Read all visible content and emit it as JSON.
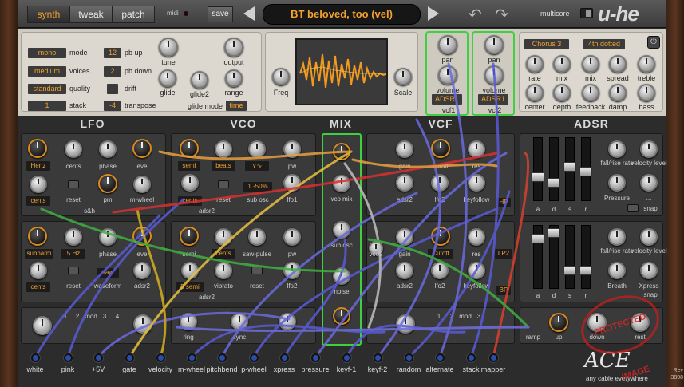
{
  "topbar": {
    "tabs": [
      {
        "label": "synth",
        "active": true
      },
      {
        "label": "tweak",
        "active": false
      },
      {
        "label": "patch",
        "active": false
      }
    ],
    "midi_label": "midi",
    "save_label": "save",
    "preset_name": "BT beloved, too (vel)",
    "multicore_label": "multicore",
    "logo_text": "u-he"
  },
  "global": {
    "mode": {
      "value": "mono",
      "label": "mode"
    },
    "voices": {
      "value": "medium",
      "label": "voices"
    },
    "quality": {
      "value": "standard",
      "label": "quality"
    },
    "stack": {
      "value": "1",
      "label": "stack"
    },
    "pb_up": {
      "value": "12",
      "label": "pb up"
    },
    "pb_down": {
      "value": "2",
      "label": "pb down"
    },
    "drift": {
      "label": "drift"
    },
    "transpose": {
      "value": "-4",
      "label": "transpose"
    },
    "knob_labels": {
      "tune": "tune",
      "output": "output",
      "glide": "glide",
      "glide2": "glide2",
      "range": "range"
    },
    "glide_mode": {
      "label": "glide mode",
      "value": "time"
    }
  },
  "scope": {
    "freq_label": "Freq",
    "scale_label": "Scale"
  },
  "vcf_outputs": [
    {
      "pan": "pan",
      "volume": "volume",
      "env": "ADSR1",
      "name": "vcf1"
    },
    {
      "pan": "pan",
      "volume": "volume",
      "env": "ADSR1",
      "name": "vcf2"
    }
  ],
  "effects": {
    "chorus": "Chorus 3",
    "delay": "4th dotted",
    "row1": [
      "rate",
      "mix",
      "mix",
      "spread",
      "treble"
    ],
    "row2": [
      "center",
      "depth",
      "feedback",
      "damp",
      "bass"
    ]
  },
  "sections": {
    "lfo": "LFO",
    "vco": "VCO",
    "mix": "MIX",
    "vcf": "VCF",
    "adsr": "ADSR"
  },
  "lfo1": {
    "rate_mode": "Hertz",
    "cents": "cents",
    "labels": [
      "phase",
      "level",
      "reset",
      "pm",
      "m-wheel",
      "s&h"
    ],
    "cents2": "cents"
  },
  "lfo2": {
    "rate_mode": "subharm",
    "ratio": "5 Hz",
    "labels": [
      "phase",
      "level",
      "reset",
      "waveform",
      "adsr2"
    ],
    "cents": "cents",
    "wave": "saw"
  },
  "vco1": {
    "semi": "semi",
    "beats": "beats",
    "cents": "cents",
    "labels": [
      "pw",
      "reset",
      "sub osc",
      "lfo1",
      "adsr2"
    ],
    "sub": "1 -50%"
  },
  "vco2": {
    "semi": "semi",
    "cents": "cents",
    "labels": [
      "saw-pulse",
      "pw",
      "vibrato",
      "reset",
      "lfo2",
      "adsr2"
    ],
    "semi_val": "5 semi"
  },
  "mix": {
    "labels": [
      "vco mix",
      "sub osc",
      "noise"
    ]
  },
  "vcf1": {
    "labels": [
      "gain",
      "cutoff",
      "res",
      "adsr2",
      "lfo2",
      "keyfollow"
    ],
    "type": "HP"
  },
  "vcf2": {
    "labels": [
      "vco2",
      "gain",
      "res",
      "adsr2",
      "lfo2",
      "keyfollow"
    ],
    "cutoff": "Cutoff",
    "type1": "LP2",
    "type2": "BP"
  },
  "adsr1": {
    "sliders": {
      "a": 0.35,
      "d": 0.25,
      "s": 0.55,
      "r": 0.45
    },
    "labels": [
      "fall/rise rate",
      "velocity level",
      "Pressure",
      "...",
      "snap"
    ],
    "slider_labels": [
      "a",
      "d",
      "s",
      "r"
    ]
  },
  "adsr2": {
    "sliders": {
      "a": 0.85,
      "d": 0.95,
      "s": 0.25,
      "r": 0.25
    },
    "labels": [
      "fall/rise rate",
      "velocity level",
      "Breath",
      "Xpress",
      "snap"
    ],
    "slider_labels": [
      "a",
      "d",
      "s",
      "r"
    ]
  },
  "bottom_row": {
    "mod_labels": [
      "1",
      "2",
      "mod",
      "3",
      "4"
    ],
    "mod_labels2": [
      "1",
      "2",
      "mod",
      "3"
    ],
    "small": [
      "ring",
      "sync"
    ],
    "env": [
      "ramp",
      "up",
      "down",
      "rest"
    ]
  },
  "sources": [
    "white",
    "pink",
    "+5V",
    "gate",
    "velocity",
    "m-wheel",
    "pitchbend",
    "p-wheel",
    "xpress",
    "pressure",
    "keyf-1",
    "keyf-2",
    "random",
    "alternate",
    "stack",
    "mapper"
  ],
  "ace": {
    "logo": "ACE",
    "tagline": "any cable everywhere"
  },
  "watermark": "PROTECTED IMAGE",
  "revision": "Rev 3898"
}
